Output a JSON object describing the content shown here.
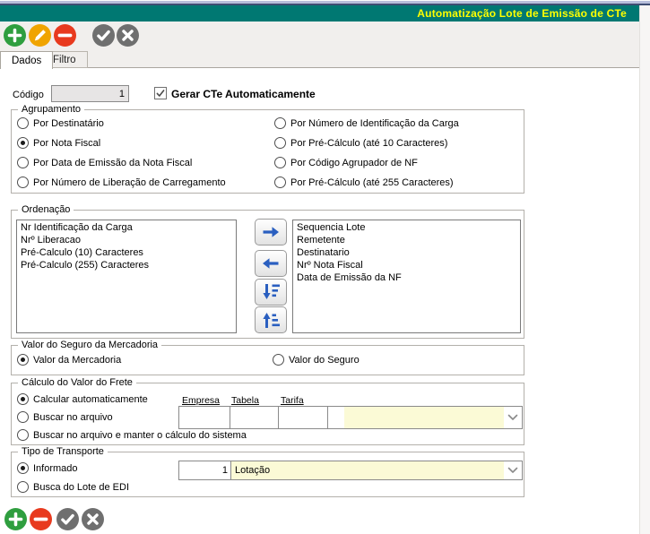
{
  "window": {
    "title": "Automatização Lote de Emissão de CTe"
  },
  "colors": {
    "titlebar_teal": "#007872",
    "title_text_yellow": "#ffff00",
    "icon_green": "#2f9e3f",
    "icon_amber": "#f0a400",
    "icon_red": "#e83a1e",
    "icon_gray": "#6f6f6f",
    "arrow_blue": "#2a5fc0",
    "combo_yellow": "#fbfad6"
  },
  "toolbar_top": {
    "icons": [
      "add-icon",
      "edit-pencil-icon",
      "remove-icon",
      "confirm-check-icon",
      "cancel-x-icon"
    ]
  },
  "toolbar_bottom": {
    "icons": [
      "add-icon",
      "remove-icon",
      "confirm-check-icon",
      "cancel-x-icon"
    ]
  },
  "tabs": [
    {
      "label": "Dados",
      "active": true
    },
    {
      "label": "Filtro",
      "active": false
    }
  ],
  "codigo": {
    "label": "Código",
    "value": "1",
    "disabled": true
  },
  "gerar_cte": {
    "label": "Gerar CTe Automaticamente",
    "checked": true
  },
  "agrupamento": {
    "title": "Agrupamento",
    "left": [
      {
        "label": "Por Destinatário",
        "selected": false
      },
      {
        "label": "Por Nota Fiscal",
        "selected": true
      },
      {
        "label": "Por Data de Emissão da Nota Fiscal",
        "selected": false
      },
      {
        "label": "Por Número de Liberação de Carregamento",
        "selected": false
      }
    ],
    "right": [
      {
        "label": "Por Número de Identificação da Carga",
        "selected": false
      },
      {
        "label": "Por Pré-Cálculo (até 10 Caracteres)",
        "selected": false
      },
      {
        "label": "Por Código Agrupador de NF",
        "selected": false
      },
      {
        "label": "Por Pré-Cálculo (até 255 Caracteres)",
        "selected": false
      }
    ]
  },
  "ordenacao": {
    "title": "Ordenação",
    "available": [
      "Nr Identificação da Carga",
      "Nrº Liberacao",
      "Pré-Calculo (10) Caracteres",
      "Pré-Calculo (255) Caracteres"
    ],
    "chosen": [
      "Sequencia Lote",
      "Remetente",
      "Destinatario",
      "Nrº Nota Fiscal",
      "Data de Emissão da NF"
    ],
    "buttons": [
      "move-right-icon",
      "move-left-icon",
      "move-down-icon",
      "move-up-icon"
    ]
  },
  "seguro": {
    "title": "Valor do Seguro da Mercadoria",
    "options": [
      {
        "label": "Valor da Mercadoria",
        "selected": true
      },
      {
        "label": "Valor do Seguro",
        "selected": false
      }
    ]
  },
  "frete": {
    "title": "Cálculo do Valor do Frete",
    "options": [
      {
        "label": "Calcular automaticamente",
        "selected": true
      },
      {
        "label": "Buscar no arquivo",
        "selected": false
      },
      {
        "label": "Buscar no arquivo e manter o cálculo do sistema",
        "selected": false
      }
    ],
    "columns": {
      "empresa": "Empresa",
      "tabela": "Tabela",
      "tarifa": "Tarifa"
    },
    "empresa_value": "",
    "tabela_value": "",
    "tarifa_value": "",
    "combo_value": ""
  },
  "transporte": {
    "title": "Tipo de Transporte",
    "options": [
      {
        "label": "Informado",
        "selected": true
      },
      {
        "label": "Busca do Lote de EDI",
        "selected": false
      }
    ],
    "code_value": "1",
    "combo_value": "Lotação"
  }
}
